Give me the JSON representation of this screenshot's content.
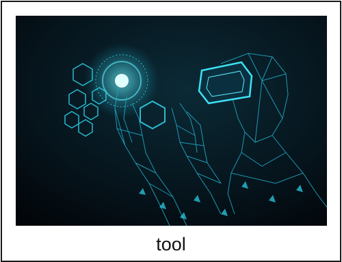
{
  "card": {
    "caption": "tool"
  },
  "illustration": {
    "subject": "vr-headset-user-touching-holographic-interface",
    "colors": {
      "background": "#04090f",
      "glow": "#2fd8f0",
      "wire": "#1fa7c4"
    }
  }
}
